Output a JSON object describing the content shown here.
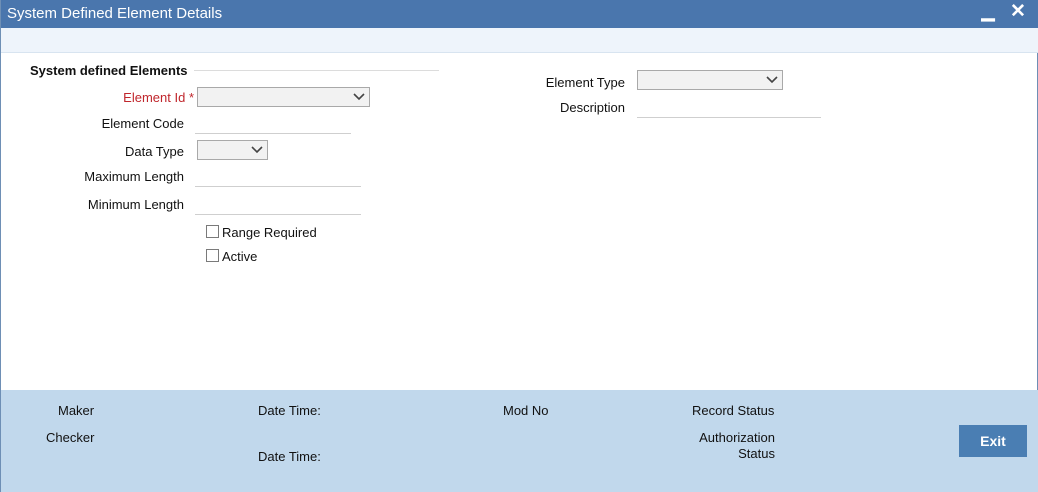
{
  "window": {
    "title": "System Defined Element Details",
    "minimize_glyph": "▁",
    "close_glyph": "✕"
  },
  "section": {
    "title": "System defined Elements"
  },
  "form": {
    "element_id": {
      "label": "Element Id",
      "required_mark": "*",
      "value": ""
    },
    "element_code": {
      "label": "Element Code",
      "value": ""
    },
    "data_type": {
      "label": "Data Type",
      "value": ""
    },
    "maximum_length": {
      "label": "Maximum Length",
      "value": ""
    },
    "minimum_length": {
      "label": "Minimum Length",
      "value": ""
    },
    "range_required": {
      "label": "Range Required",
      "checked": false
    },
    "active": {
      "label": "Active",
      "checked": false
    },
    "element_type": {
      "label": "Element Type",
      "value": ""
    },
    "description": {
      "label": "Description",
      "value": ""
    }
  },
  "footer": {
    "maker": "Maker",
    "checker": "Checker",
    "date_time_1": "Date Time:",
    "date_time_2": "Date Time:",
    "mod_no": "Mod No",
    "record_status": "Record Status",
    "authorization_status_line1": "Authorization",
    "authorization_status_line2": "Status",
    "exit_label": "Exit"
  },
  "colors": {
    "titlebar": "#4a76ad",
    "footer": "#c1d8ec",
    "required": "#c0262c",
    "exit_button": "#4a7eb3"
  },
  "icons": {
    "dropdown": "chevron-down-icon",
    "minimize": "minimize-icon",
    "close": "close-icon"
  }
}
